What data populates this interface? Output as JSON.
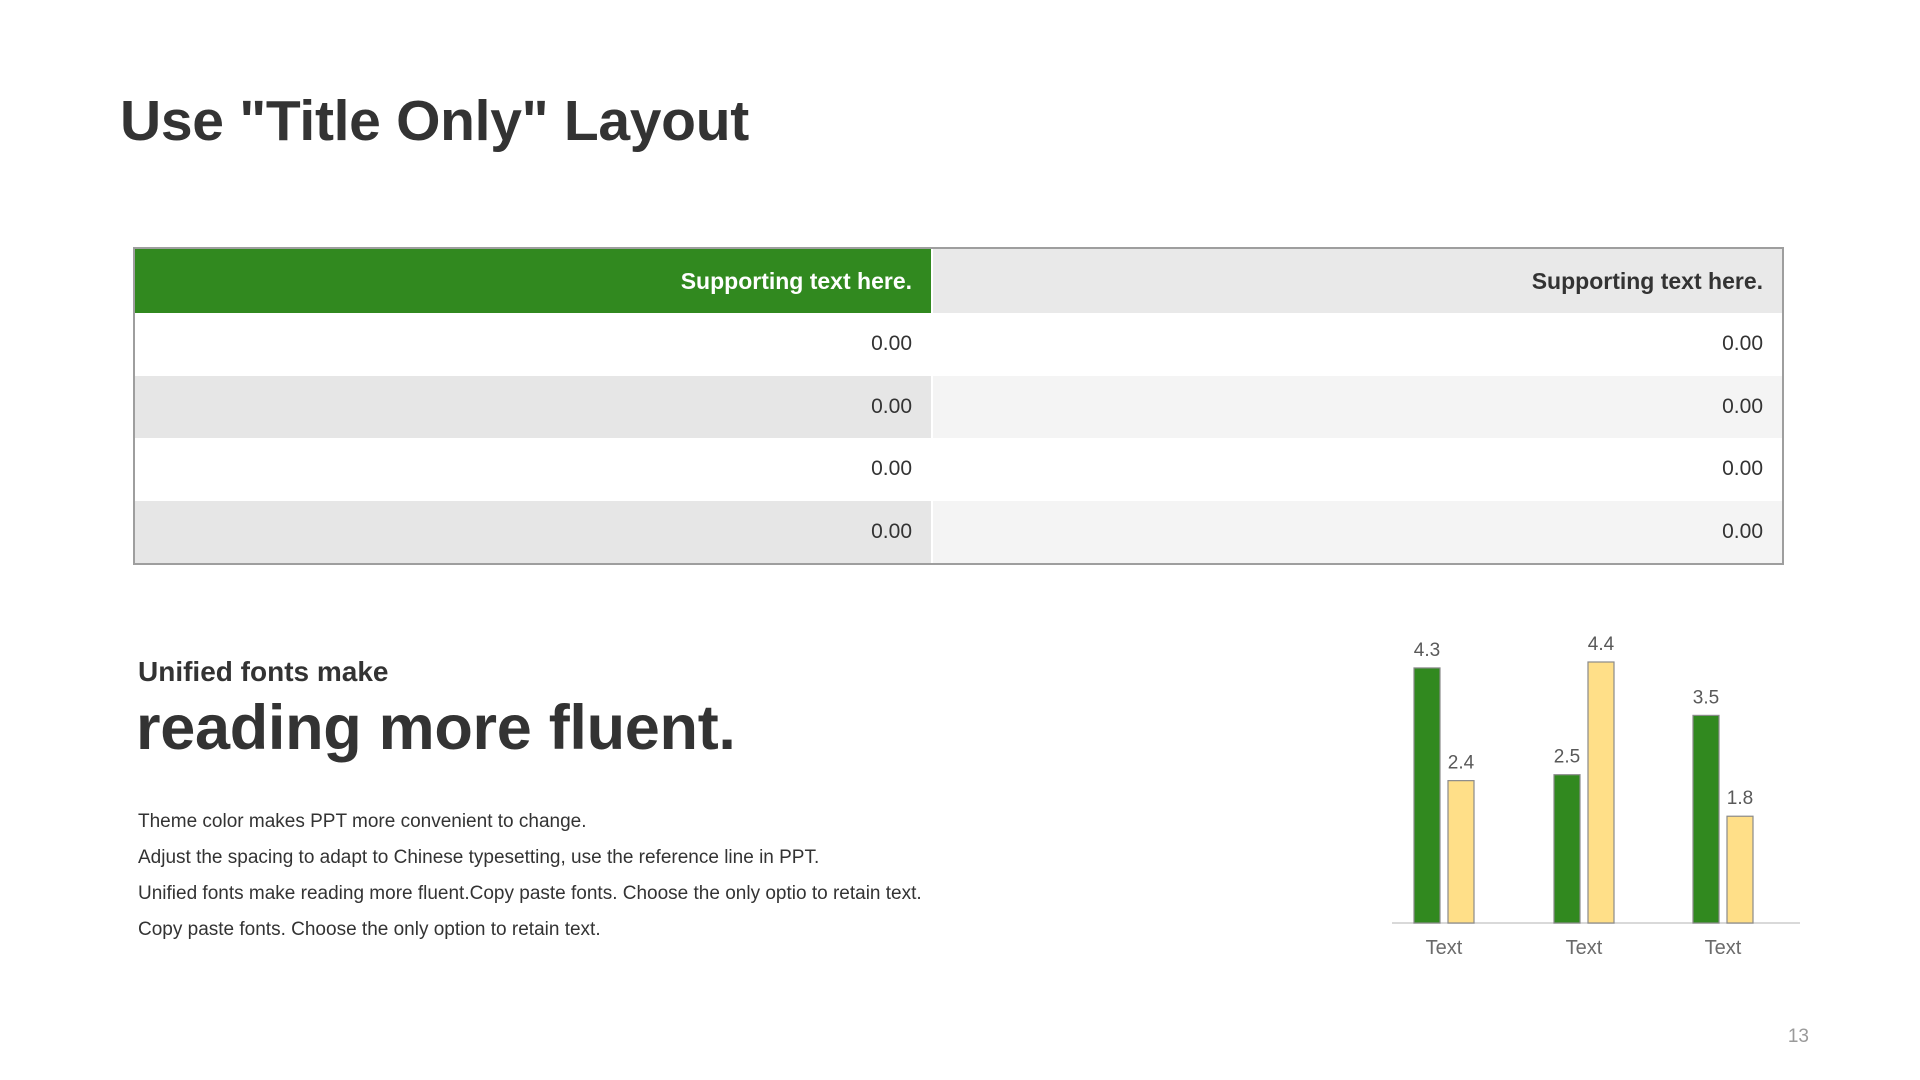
{
  "slide": {
    "title": "Use \"Title Only\" Layout",
    "page_number": "13"
  },
  "table": {
    "headers": [
      "Supporting text here.",
      "Supporting text here."
    ],
    "rows": [
      [
        "0.00",
        "0.00"
      ],
      [
        "0.00",
        "0.00"
      ],
      [
        "0.00",
        "0.00"
      ],
      [
        "0.00",
        "0.00"
      ]
    ]
  },
  "text_block": {
    "subtitle": "Unified fonts make",
    "headline": "reading more fluent.",
    "lines": [
      "Theme color makes PPT more convenient  to change.",
      "Adjust the spacing to adapt to Chinese  typesetting, use the reference line in PPT.",
      "Unified  fonts make reading more fluent.Copy paste fonts. Choose the only optio to retain text.",
      "Copy paste  fonts. Choose the only option to retain text."
    ]
  },
  "colors": {
    "accent_green": "#31891f",
    "accent_yellow": "#ffdf88",
    "text": "#333333",
    "header_gray": "#e9e9e9"
  },
  "chart_data": {
    "type": "bar",
    "categories": [
      "Text",
      "Text",
      "Text"
    ],
    "series": [
      {
        "values": [
          4.3,
          2.5,
          3.5
        ],
        "color": "#31891f"
      },
      {
        "values": [
          2.4,
          4.4,
          1.8
        ],
        "color": "#ffdf88"
      }
    ],
    "title": "",
    "xlabel": "",
    "ylabel": "",
    "ylim": [
      0,
      4.4
    ],
    "grid": false,
    "legend": "none",
    "data_labels": true
  }
}
